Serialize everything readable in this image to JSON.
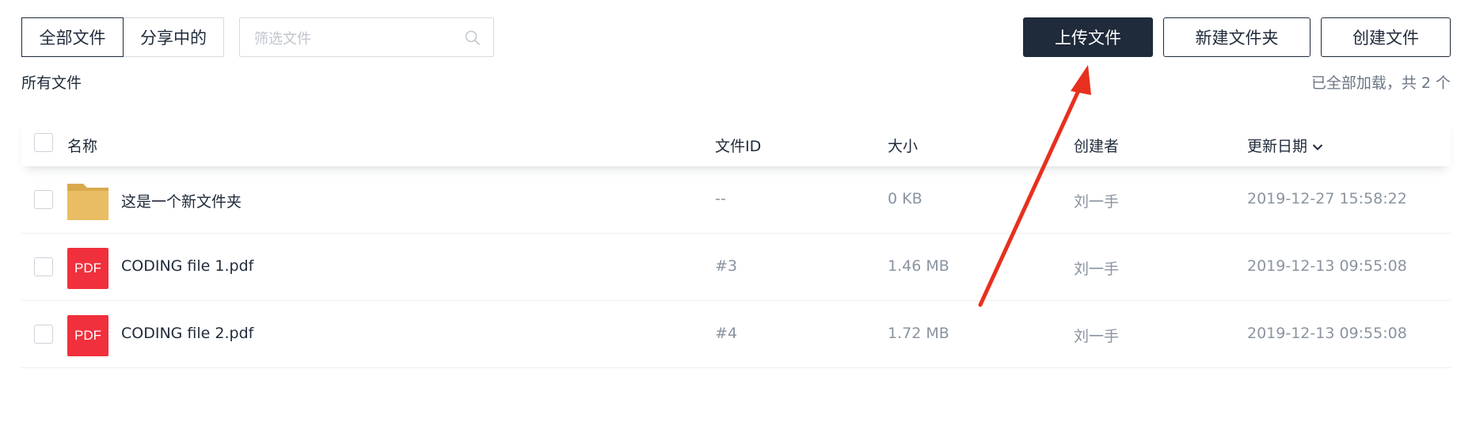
{
  "toolbar": {
    "tab_all": "全部文件",
    "tab_shared": "分享中的",
    "search_placeholder": "筛选文件",
    "upload_label": "上传文件",
    "new_folder_label": "新建文件夹",
    "create_file_label": "创建文件"
  },
  "breadcrumb": "所有文件",
  "load_status": "已全部加载，共 2 个",
  "table": {
    "headers": {
      "name": "名称",
      "file_id": "文件ID",
      "size": "大小",
      "creator": "创建者",
      "updated": "更新日期"
    },
    "rows": [
      {
        "icon": "folder-icon",
        "name": "这是一个新文件夹",
        "file_id": "--",
        "size": "0 KB",
        "creator": "刘一手",
        "updated": "2019-12-27 15:58:22"
      },
      {
        "icon": "pdf-icon",
        "badge": "PDF",
        "name": "CODING file 1.pdf",
        "file_id": "#3",
        "size": "1.46 MB",
        "creator": "刘一手",
        "updated": "2019-12-13 09:55:08"
      },
      {
        "icon": "pdf-icon",
        "badge": "PDF",
        "name": "CODING file 2.pdf",
        "file_id": "#4",
        "size": "1.72 MB",
        "creator": "刘一手",
        "updated": "2019-12-13 09:55:08"
      }
    ]
  },
  "colors": {
    "primary": "#1f2a3a",
    "pdf_red": "#f0303d",
    "folder_yellow": "#e9bd63",
    "annotation_arrow": "#e8301f"
  }
}
